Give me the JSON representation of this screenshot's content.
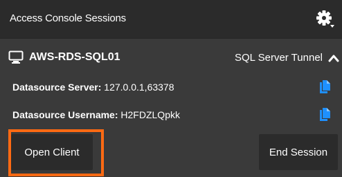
{
  "header": {
    "title": "Access Console Sessions",
    "settings_icon": "gear-icon"
  },
  "session": {
    "icon": "monitor-icon",
    "name": "AWS-RDS-SQL01",
    "type": "SQL Server Tunnel",
    "expand_icon": "chevron-up-icon",
    "details": [
      {
        "label": "Datasource Server:",
        "value": "127.0.0.1,63378",
        "copy_icon": "copy-icon"
      },
      {
        "label": "Datasource Username:",
        "value": "H2FDZLQpkk",
        "copy_icon": "copy-icon"
      }
    ]
  },
  "actions": {
    "open_client_label": "Open Client",
    "end_session_label": "End Session"
  },
  "colors": {
    "background": "#3a3a3a",
    "header_background": "#2b2b2b",
    "button_background": "#2b2b2b",
    "text": "#ffffff",
    "copy_icon": "#1e90ff",
    "highlight": "#ff6a13"
  }
}
